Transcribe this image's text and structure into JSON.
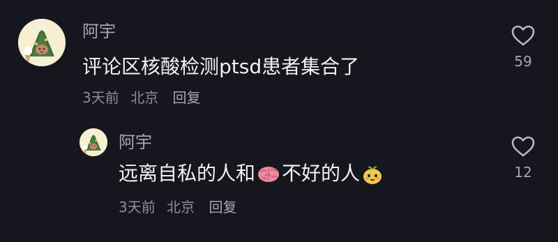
{
  "comments": [
    {
      "username": "阿宇",
      "text": "评论区核酸检测ptsd患者集合了",
      "time": "3天前",
      "location": "北京",
      "reply_label": "回复",
      "likes": "59",
      "like_icon": "heart-outline-icon"
    },
    {
      "username": "阿宇",
      "text_before": "远离自私的人和",
      "emoji_1": "brain-emoji-icon",
      "text_after": "不好的人",
      "emoji_2": "cute-fruit-face-emoji-icon",
      "time": "3天前",
      "location": "北京",
      "reply_label": "回复",
      "likes": "12",
      "like_icon": "heart-outline-icon"
    }
  ],
  "colors": {
    "background": "#16161e",
    "text": "#f2f2f2",
    "muted": "#8e8e98",
    "username": "#a6a6b0",
    "brain": "#f08aa0"
  }
}
